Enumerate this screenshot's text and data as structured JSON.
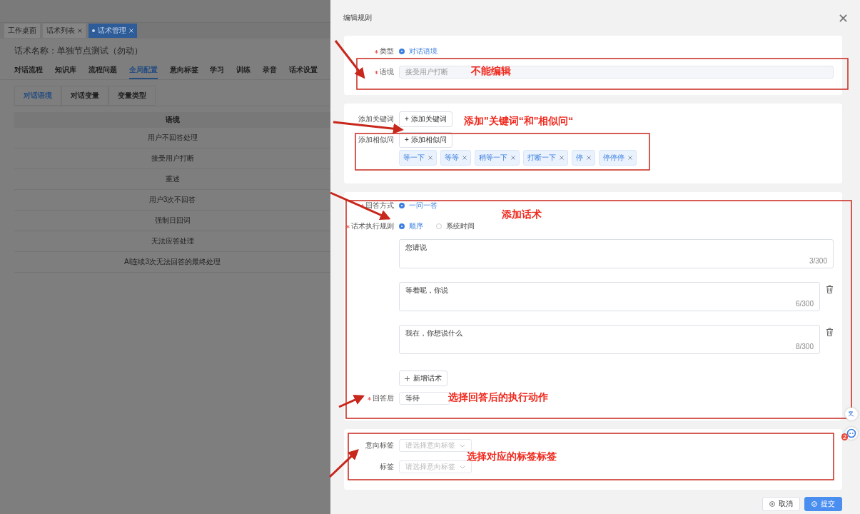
{
  "background_page": {
    "tabs": [
      {
        "label": "工作桌面",
        "selected": false,
        "closable": false
      },
      {
        "label": "话术列表",
        "selected": false,
        "closable": true
      },
      {
        "label": "话术管理",
        "selected": true,
        "closable": true
      }
    ],
    "title": "话术名称：单独节点测试（勿动）",
    "nav": [
      {
        "label": "对话流程",
        "selected": false
      },
      {
        "label": "知识库",
        "selected": false
      },
      {
        "label": "流程问题",
        "selected": false
      },
      {
        "label": "全局配置",
        "selected": true
      },
      {
        "label": "意向标签",
        "selected": false
      },
      {
        "label": "学习",
        "selected": false
      },
      {
        "label": "训练",
        "selected": false
      },
      {
        "label": "录音",
        "selected": false
      },
      {
        "label": "话术设置",
        "selected": false
      }
    ],
    "subtabs": [
      {
        "label": "对话语境",
        "selected": true
      },
      {
        "label": "对话变量",
        "selected": false
      },
      {
        "label": "变量类型",
        "selected": false
      }
    ],
    "table": {
      "columns": [
        "语境"
      ],
      "rows": [
        [
          "用户不回答处理"
        ],
        [
          "接受用户打断"
        ],
        [
          "重述"
        ],
        [
          "用户3次不回答"
        ],
        [
          "强制日回词"
        ],
        [
          "无法应答处理"
        ],
        [
          "AI连续3次无法回答的最终处理"
        ]
      ]
    }
  },
  "drawer": {
    "title": "编辑规则",
    "sections": [
      {
        "rows": [
          {
            "kind": "radio",
            "label": "类型",
            "required": true,
            "options": [
              {
                "label": "对话语境",
                "selected": true
              }
            ]
          },
          {
            "kind": "input",
            "label": "语境",
            "required": true,
            "value": "接受用户打断",
            "disabled": true
          }
        ]
      },
      {
        "rows": [
          {
            "kind": "button",
            "label": "添加关键词",
            "required": false,
            "button": "+ 添加关键词"
          },
          {
            "kind": "button",
            "label": "添加相似问",
            "required": false,
            "button": "+ 添加相似问"
          },
          {
            "kind": "tags",
            "tags": [
              "等一下",
              "等等",
              "稍等一下",
              "打断一下",
              "停",
              "停停停"
            ]
          }
        ]
      },
      {
        "rows": [
          {
            "kind": "radio",
            "label": "回答方式",
            "required": true,
            "options": [
              {
                "label": "一问一答",
                "selected": true
              }
            ]
          },
          {
            "kind": "radio",
            "label": "话术执行规则",
            "required": true,
            "options": [
              {
                "label": "顺序",
                "selected": true
              },
              {
                "label": "系统时间",
                "selected": false
              }
            ]
          },
          {
            "kind": "textareas",
            "items": [
              {
                "text": "您请说",
                "count": "3/300",
                "deletable": false
              },
              {
                "text": "等着呢，你说",
                "count": "6/300",
                "deletable": true
              },
              {
                "text": "我在，你想说什么",
                "count": "8/300",
                "deletable": true
              }
            ]
          },
          {
            "kind": "add",
            "button": "新增话术"
          },
          {
            "kind": "select",
            "label": "回答后",
            "required": true,
            "value": "等待"
          }
        ]
      },
      {
        "rows": [
          {
            "kind": "select",
            "label": "意向标签",
            "required": false,
            "placeholder": "请选择意向标签"
          },
          {
            "kind": "select",
            "label": "标签",
            "required": false,
            "placeholder": "请选择意向标签"
          }
        ]
      }
    ],
    "footer": [
      {
        "label": "取消",
        "primary": false
      },
      {
        "label": "提交",
        "primary": true
      }
    ]
  },
  "side_badge": "2",
  "annotations": [
    {
      "text": "不能编辑"
    },
    {
      "text": "添加\"关键词“和\"相似问“"
    },
    {
      "text": "添加话术"
    },
    {
      "text": "选择回答后的执行动作"
    },
    {
      "text": "选择对应的标签标签"
    }
  ]
}
